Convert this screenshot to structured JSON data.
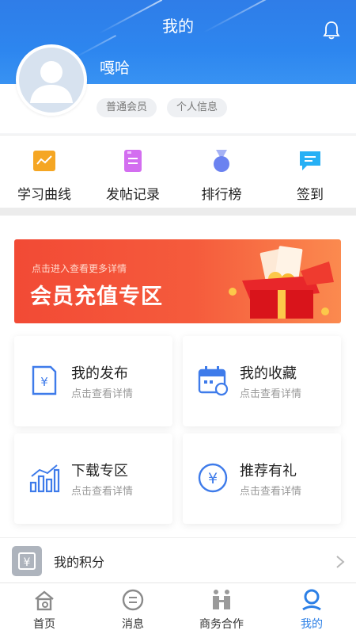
{
  "header": {
    "title": "我的"
  },
  "profile": {
    "username": "嘎哈",
    "tags": [
      "普通会员",
      "个人信息"
    ]
  },
  "quick_menu": [
    {
      "label": "学习曲线",
      "icon": "chart-icon",
      "color": "#f5a623"
    },
    {
      "label": "发帖记录",
      "icon": "post-record-icon",
      "color": "#d36ef0"
    },
    {
      "label": "排行榜",
      "icon": "medal-icon",
      "color": "#6b82f0"
    },
    {
      "label": "签到",
      "icon": "chat-checkin-icon",
      "color": "#26b0f5"
    }
  ],
  "banner": {
    "subtitle": "点击进入查看更多详情",
    "title": "会员充值专区"
  },
  "cards": [
    {
      "title": "我的发布",
      "subtitle": "点击查看详情",
      "icon": "publish-doc-icon"
    },
    {
      "title": "我的收藏",
      "subtitle": "点击查看详情",
      "icon": "calendar-icon"
    },
    {
      "title": "下载专区",
      "subtitle": "点击查看详情",
      "icon": "bar-chart-icon"
    },
    {
      "title": "推荐有礼",
      "subtitle": "点击查看详情",
      "icon": "yuan-circle-icon"
    }
  ],
  "points": {
    "label": "我的积分",
    "icon": "yuan-box-icon"
  },
  "tabbar": [
    {
      "label": "首页",
      "icon": "home-icon",
      "active": false
    },
    {
      "label": "消息",
      "icon": "message-icon",
      "active": false
    },
    {
      "label": "商务合作",
      "icon": "cooperation-icon",
      "active": false
    },
    {
      "label": "我的",
      "icon": "user-pin-icon",
      "active": true
    }
  ],
  "colors": {
    "primary": "#2b7fe6",
    "banner": "#f24a35"
  }
}
